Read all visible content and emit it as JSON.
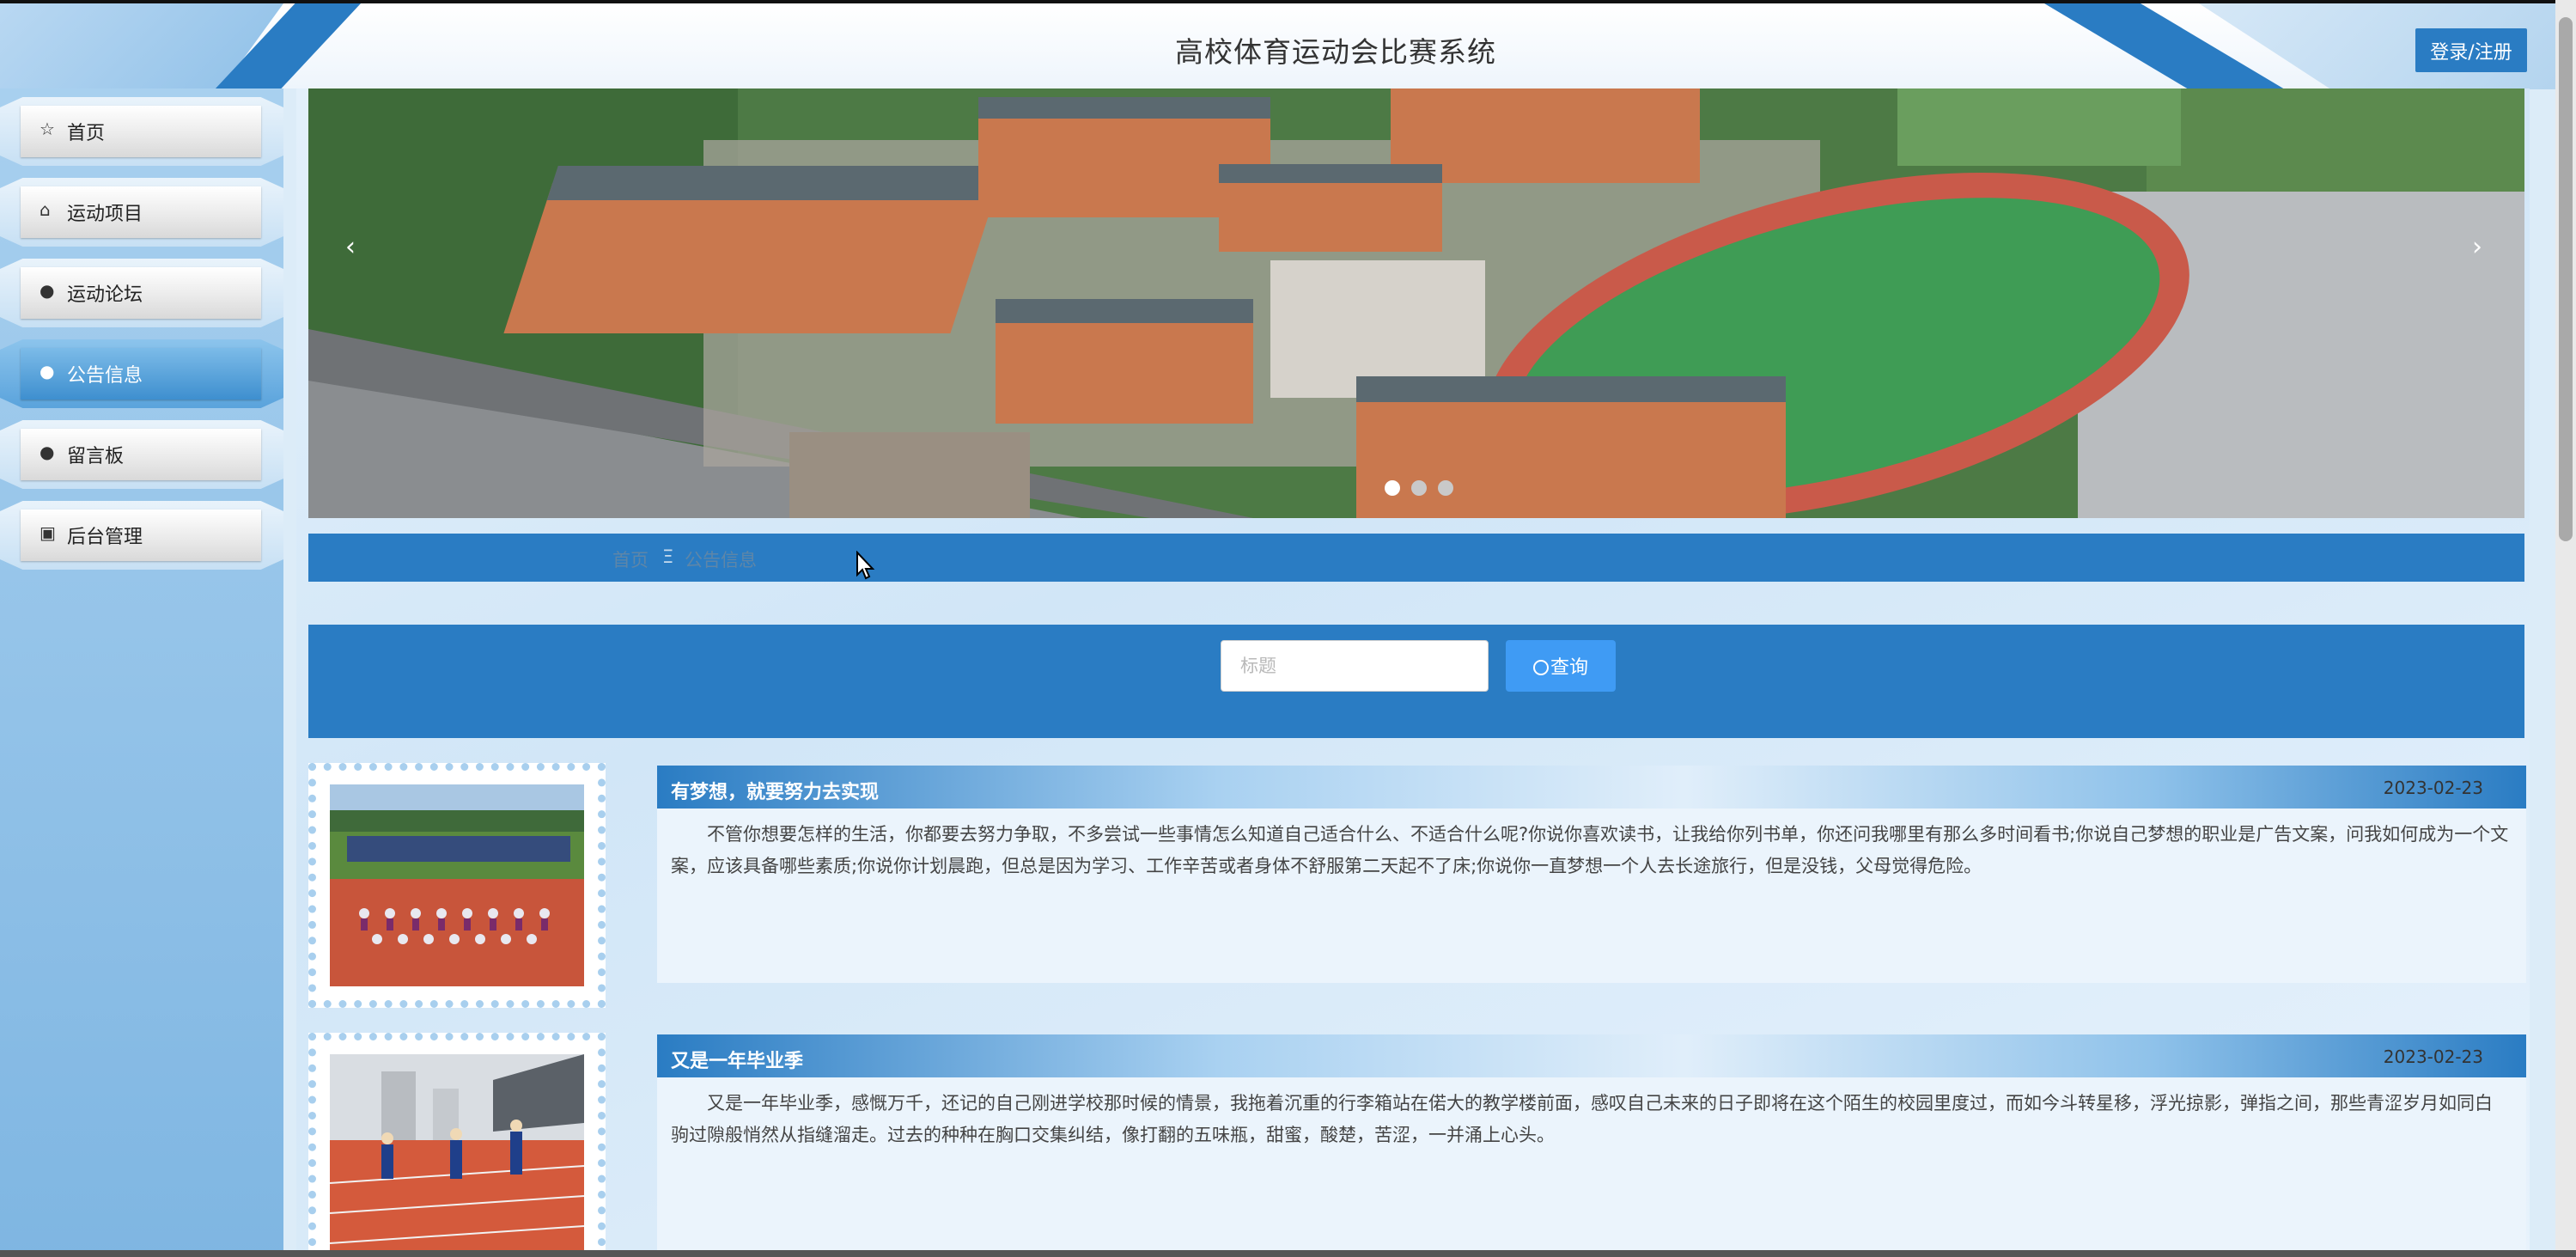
{
  "header": {
    "title": "高校体育运动会比赛系统",
    "login_label": "登录/注册"
  },
  "sidebar": {
    "items": [
      {
        "label": "首页",
        "icon": "star-outline-icon",
        "glyph": "☆",
        "active": false
      },
      {
        "label": "运动项目",
        "icon": "bag-icon",
        "glyph": "⌂",
        "active": false
      },
      {
        "label": "运动论坛",
        "icon": "info-circle-icon",
        "glyph": "●",
        "active": false
      },
      {
        "label": "公告信息",
        "icon": "circle-icon",
        "glyph": "●",
        "active": true
      },
      {
        "label": "留言板",
        "icon": "info-circle-icon",
        "glyph": "●",
        "active": false
      },
      {
        "label": "后台管理",
        "icon": "briefcase-icon",
        "glyph": "▣",
        "active": false
      }
    ]
  },
  "banner": {
    "prev_glyph": "‹",
    "next_glyph": "›",
    "dots": 3,
    "active_dot": 1
  },
  "breadcrumb": {
    "home": "首页",
    "separator": "Ξ",
    "current": "公告信息"
  },
  "search": {
    "placeholder": "标题",
    "value": "",
    "button_label": "查询"
  },
  "news": [
    {
      "title": "有梦想，就要努力去实现",
      "date": "2023-02-23",
      "content": "不管你想要怎样的生活，你都要去努力争取，不多尝试一些事情怎么知道自己适合什么、不适合什么呢?你说你喜欢读书，让我给你列书单，你还问我哪里有那么多时间看书;你说自己梦想的职业是广告文案，问我如何成为一个文案，应该具备哪些素质;你说你计划晨跑，但总是因为学习、工作辛苦或者身体不舒服第二天起不了床;你说你一直梦想一个人去长途旅行，但是没钱，父母觉得危险。"
    },
    {
      "title": "又是一年毕业季",
      "date": "2023-02-23",
      "content": "又是一年毕业季，感慨万千，还记的自己刚进学校那时候的情景，我拖着沉重的行李箱站在偌大的教学楼前面，感叹自己未来的日子即将在这个陌生的校园里度过，而如今斗转星移，浮光掠影，弹指之间，那些青涩岁月如同白驹过隙般悄然从指缝溜走。过去的种种在胸口交集纠结，像打翻的五味瓶，甜蜜，酸楚，苦涩，一并涌上心头。"
    }
  ],
  "colors": {
    "primary": "#2a7cc3",
    "search_button": "#3f9bf4",
    "sidebar_bg": "#8fc0e8"
  }
}
